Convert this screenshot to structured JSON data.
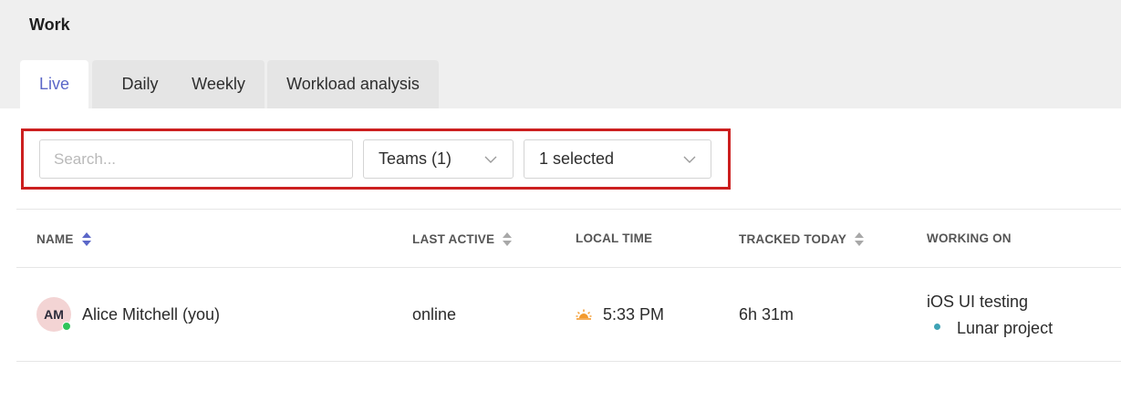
{
  "header": {
    "title": "Work"
  },
  "tabs": [
    {
      "label": "Live",
      "active": true
    },
    {
      "label": "Daily",
      "active": false
    },
    {
      "label": "Weekly",
      "active": false
    },
    {
      "label": "Workload analysis",
      "active": false
    }
  ],
  "filters": {
    "search_placeholder": "Search...",
    "teams_select": "Teams (1)",
    "members_select": "1 selected"
  },
  "table": {
    "columns": [
      {
        "label": "NAME",
        "sortable": true,
        "sorted": true
      },
      {
        "label": "LAST ACTIVE",
        "sortable": true,
        "sorted": false
      },
      {
        "label": "LOCAL TIME",
        "sortable": false
      },
      {
        "label": "TRACKED TODAY",
        "sortable": true,
        "sorted": false
      },
      {
        "label": "WORKING ON",
        "sortable": false
      }
    ],
    "rows": [
      {
        "initials": "AM",
        "name": "Alice Mitchell (you)",
        "status": "online",
        "last_active": "online",
        "local_time": "5:33 PM",
        "local_time_icon": "sunset-icon",
        "tracked_today": "6h 31m",
        "task": "iOS UI testing",
        "project": "Lunar project",
        "project_color": "#3fa3b5"
      }
    ]
  },
  "colors": {
    "accent": "#5b67c8",
    "highlight_frame": "#cc1f1f",
    "online": "#2fc45a",
    "avatar_bg": "#f3d4d4"
  }
}
